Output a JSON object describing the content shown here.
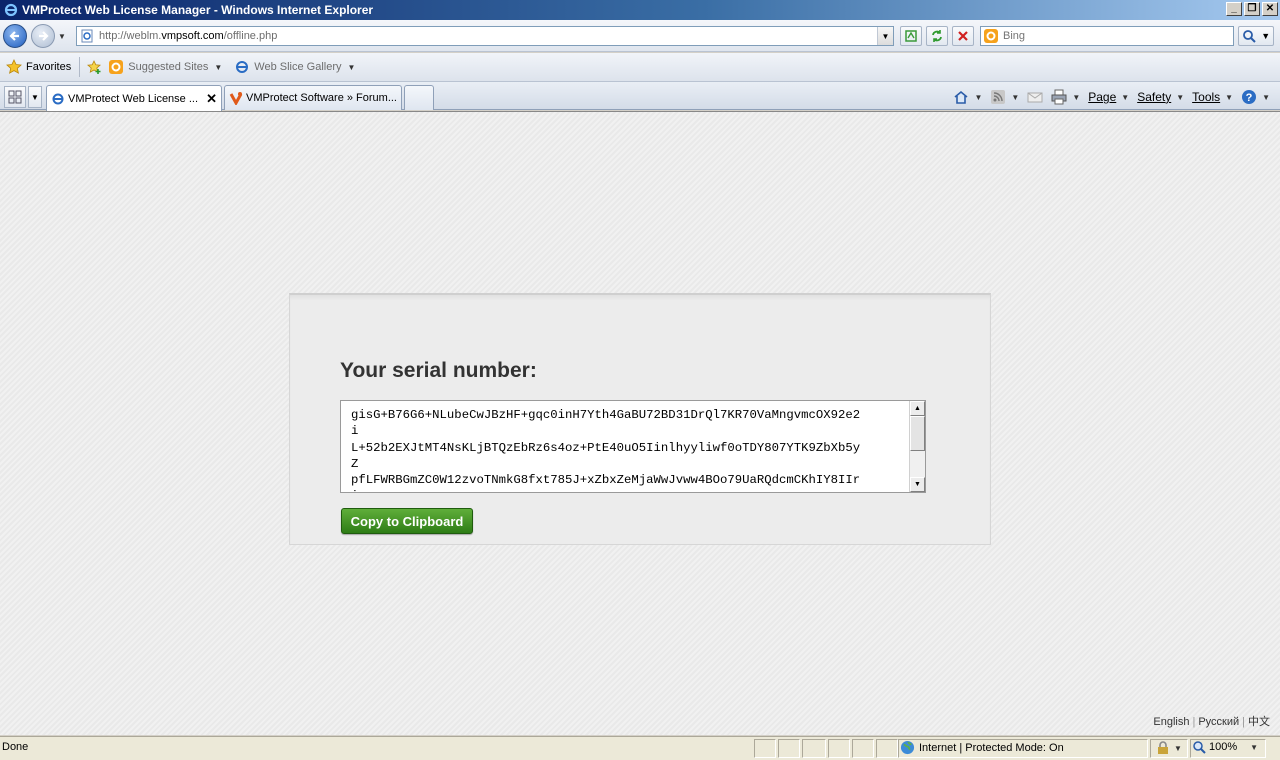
{
  "window": {
    "title": "VMProtect Web License Manager - Windows Internet Explorer",
    "buttons": [
      "minimize",
      "restore",
      "close"
    ]
  },
  "address_bar": {
    "url_prefix": "http://weblm.",
    "url_domain": "vmpsoft.com",
    "url_path": "/offline.php"
  },
  "search": {
    "placeholder": "Bing"
  },
  "favorites_bar": {
    "favorites_label": "Favorites",
    "suggested_sites": "Suggested Sites",
    "web_slice_gallery": "Web Slice Gallery"
  },
  "tabs": [
    {
      "label": "VMProtect Web License ...",
      "active": true
    },
    {
      "label": "VMProtect Software » Forum...",
      "active": false
    }
  ],
  "command_bar": {
    "page": "Page",
    "safety": "Safety",
    "tools": "Tools"
  },
  "main": {
    "heading": "Your serial number:",
    "serial_lines": [
      "gisG+B76G6+NLubeCwJBzHF+gqc0inH7Yth4GaBU72BD31DrQl7KR70VaMngvmcOX92e2",
      "i",
      "L+52b2EXJtMT4NsKLjBTQzEbRz6s4oz+PtE40uO5Iinlhyyliwf0oTDY807YTK9ZbXb5y",
      "Z",
      "pfLFWRBGmZC0W12zvoTNmkG8fxt785J+xZbxZeMjaWwJvww4BOo79UaRQdcmCKhIY8IIr",
      "i"
    ],
    "copy_button": "Copy to Clipboard",
    "languages": [
      "English",
      "Русский",
      "中文"
    ]
  },
  "status_bar": {
    "status": "Done",
    "zone": "Internet | Protected Mode: On",
    "zoom": "100%"
  },
  "colors": {
    "copy_button": "#3f8f22",
    "titlebar": "#0a246a"
  }
}
